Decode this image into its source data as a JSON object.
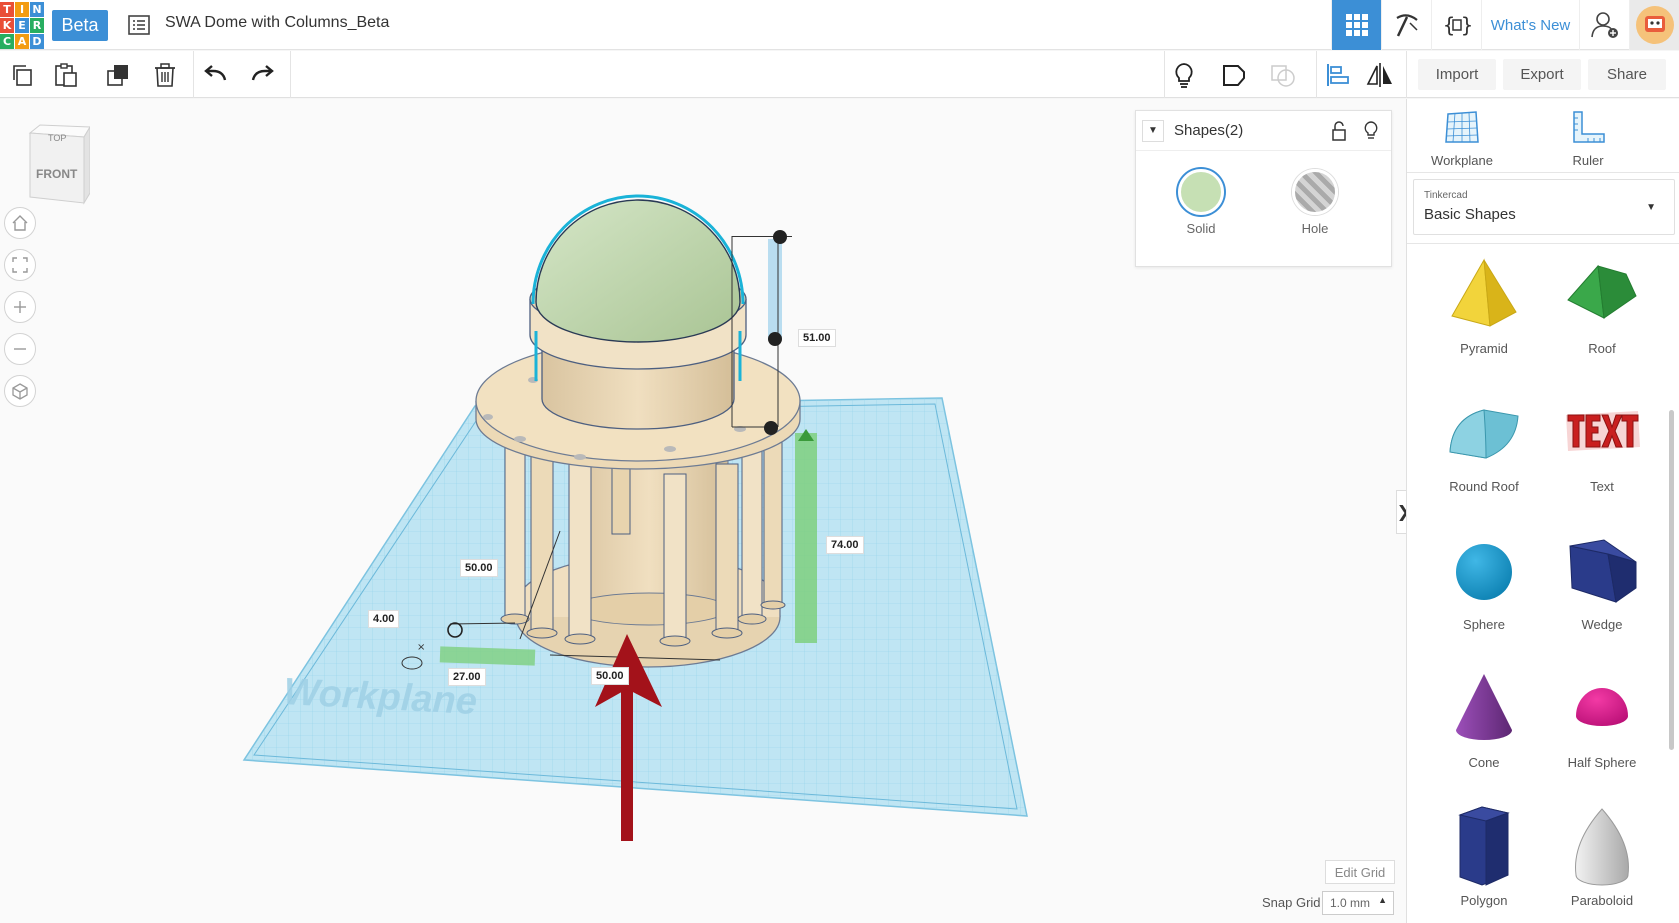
{
  "app": {
    "logo_letters": [
      "T",
      "I",
      "N",
      "K",
      "E",
      "R",
      "C",
      "A",
      "D"
    ],
    "logo_colors": [
      "#e94f37",
      "#f39c12",
      "#3c8fd6",
      "#e94f37",
      "#3c8fd6",
      "#27ae60",
      "#27ae60",
      "#f39c12",
      "#3c8fd6"
    ],
    "badge": "Beta",
    "document_title": "SWA Dome with Columns_Beta"
  },
  "header": {
    "whats_new": "What's New",
    "accent": "#3c8fd6"
  },
  "toolbar": {
    "import_label": "Import",
    "export_label": "Export",
    "share_label": "Share"
  },
  "viewcube": {
    "top_label": "TOP",
    "front_label": "FRONT"
  },
  "scene": {
    "workplane_label": "Workplane",
    "dimensions": {
      "height_dome": "51.00",
      "height_total": "74.00",
      "width": "50.00",
      "offset_small": "4.00",
      "offset_x": "27.00",
      "depth": "50.00"
    }
  },
  "inspector": {
    "title": "Shapes(2)",
    "solid_label": "Solid",
    "hole_label": "Hole",
    "solid_color": "#c6e0b4"
  },
  "grid": {
    "edit_grid_label": "Edit Grid",
    "snap_grid_label": "Snap Grid",
    "snap_value": "1.0 mm"
  },
  "right_panel": {
    "workplane_label": "Workplane",
    "ruler_label": "Ruler",
    "library_small": "Tinkercad",
    "library_name": "Basic Shapes",
    "shapes": [
      {
        "name": "Pyramid",
        "icon": "pyramid-icon"
      },
      {
        "name": "Roof",
        "icon": "roof-icon"
      },
      {
        "name": "Round Roof",
        "icon": "round-roof-icon"
      },
      {
        "name": "Text",
        "icon": "text-shape-icon"
      },
      {
        "name": "Sphere",
        "icon": "sphere-icon"
      },
      {
        "name": "Wedge",
        "icon": "wedge-icon"
      },
      {
        "name": "Cone",
        "icon": "cone-icon"
      },
      {
        "name": "Half Sphere",
        "icon": "half-sphere-icon"
      },
      {
        "name": "Polygon",
        "icon": "polygon-icon"
      },
      {
        "name": "Paraboloid",
        "icon": "paraboloid-icon"
      }
    ]
  }
}
